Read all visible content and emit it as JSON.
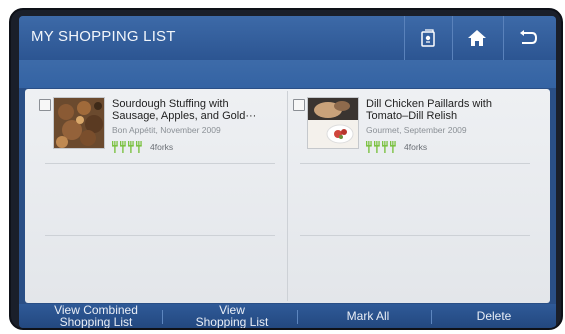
{
  "header": {
    "title": "MY SHOPPING LIST",
    "buttons": [
      {
        "name": "recipe-card-icon"
      },
      {
        "name": "home-icon"
      },
      {
        "name": "back-icon"
      }
    ]
  },
  "items": [
    {
      "title": "Sourdough Stuffing with Sausage, Apples, and Gold···",
      "source": "Bon Appétit, November 2009",
      "rating_label": "4forks",
      "rating": 4
    },
    {
      "title": "Dill Chicken Paillards with Tomato–Dill Relish",
      "source": "Gourmet, September 2009",
      "rating_label": "4forks",
      "rating": 4
    }
  ],
  "toolbar": {
    "view_combined_line1": "View Combined",
    "view_combined_line2": "Shopping List",
    "view_line1": "View",
    "view_line2": "Shopping List",
    "mark_all": "Mark All",
    "delete": "Delete"
  },
  "colors": {
    "header_blue": "#3d6aa8",
    "fork_green": "#7cc243"
  }
}
